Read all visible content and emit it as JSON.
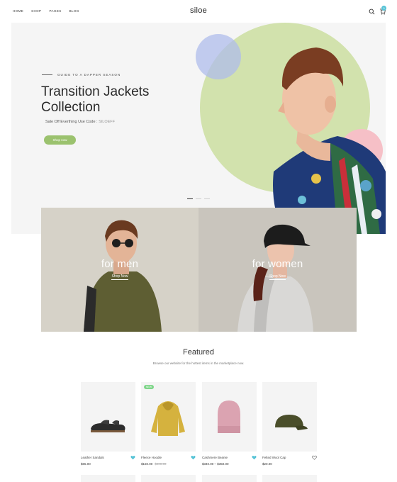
{
  "header": {
    "nav": [
      "HOME",
      "SHOP",
      "PAGES",
      "BLOG"
    ],
    "logo": "siloe",
    "cart_count": "0"
  },
  "hero": {
    "subtitle": "GUIDE TO A DAPPER SEASON",
    "title_line1": "Transition Jackets",
    "title_line2": "Collection",
    "code_text": "Sale Off Everthing Use Code :",
    "code": "SILOEFF",
    "button": "Shop now"
  },
  "banners": {
    "men": {
      "title": "for men",
      "link": "Shop Now"
    },
    "women": {
      "title": "for women",
      "link": "Shop Now"
    }
  },
  "featured": {
    "title": "Featured",
    "subtitle": "Browse our website for the hottest items in the marketplace now."
  },
  "products": [
    {
      "name": "Leather Sandals",
      "price": "$65.00",
      "old_price": "",
      "badge": ""
    },
    {
      "name": "Fleece Hoodie",
      "price": "$150.00",
      "old_price": "$200.00",
      "badge": "NEW"
    },
    {
      "name": "Cashmere Beanie",
      "price": "$340.00 – $350.00",
      "old_price": "",
      "badge": ""
    },
    {
      "name": "Felted Wool Cap",
      "price": "$20.00",
      "old_price": "",
      "badge": ""
    }
  ],
  "colors": {
    "accent_green": "#9bc26e",
    "accent_blue": "#56c3d6",
    "hero_circle": "#d2e2ad"
  }
}
